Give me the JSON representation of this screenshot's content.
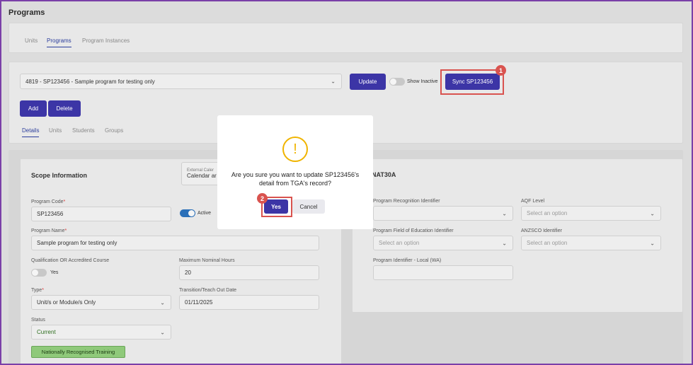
{
  "page": {
    "title": "Programs"
  },
  "top_tabs": [
    {
      "label": "Units"
    },
    {
      "label": "Programs"
    },
    {
      "label": "Program Instances"
    }
  ],
  "toolbar": {
    "program_select": "4819 - SP123456 - Sample program for testing only",
    "update_label": "Update",
    "show_inactive_label": "Show Inactive",
    "sync_label": "Sync SP123456",
    "add_label": "Add",
    "delete_label": "Delete"
  },
  "sub_tabs": [
    {
      "label": "Details"
    },
    {
      "label": "Units"
    },
    {
      "label": "Students"
    },
    {
      "label": "Groups"
    }
  ],
  "scope": {
    "title": "Scope Information",
    "external_calendar_label": "External Caler",
    "external_calendar_value": "Calendar ar",
    "program_code_label": "Program Code",
    "program_code_value": "SP123456",
    "active_label": "Active",
    "program_name_label": "Program Name",
    "program_name_value": "Sample program for testing only",
    "qualification_label": "Qualification OR Accredited Course",
    "qualification_toggle_label": "Yes",
    "max_hours_label": "Maximum Nominal Hours",
    "max_hours_value": "20",
    "type_label": "Type",
    "type_value": "Unit/s or Module/s Only",
    "transition_label": "Transition/Teach Out Date",
    "transition_value": "01/11/2025",
    "status_label": "Status",
    "status_value": "Current",
    "badge": "Nationally Recognised Training"
  },
  "nat": {
    "title": "NAT30A",
    "recognition_label": "Program Recognition Identifier",
    "recognition_value": "",
    "aqf_label": "AQF Level",
    "aqf_placeholder": "Select an option",
    "field_label": "Program Field of Education Identifier",
    "field_placeholder": "Select an option",
    "anzsco_label": "ANZSCO Identifier",
    "anzsco_placeholder": "Select an option",
    "local_label": "Program Identifier - Local (WA)",
    "local_value": ""
  },
  "dialog": {
    "message": "Are you sure you want to update SP123456's detail from TGA's record?",
    "yes_label": "Yes",
    "cancel_label": "Cancel"
  },
  "callouts": {
    "one": "1",
    "two": "2"
  },
  "colors": {
    "primary": "#3c35a6",
    "accent_blue": "#2c3e9c",
    "highlight_red": "#d9534f",
    "warning": "#f0b400",
    "badge_green": "#8fc97a",
    "frame": "#7a3fa8"
  },
  "icons": {
    "chevron": "chevron-down-icon",
    "warning": "warning-icon"
  }
}
